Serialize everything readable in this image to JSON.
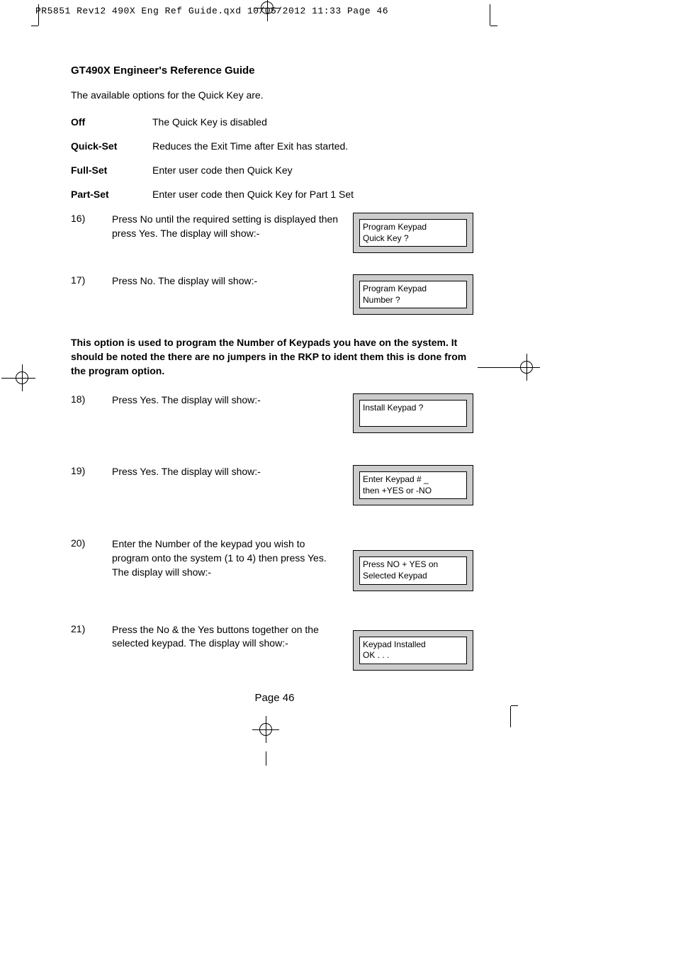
{
  "header": "PR5851 Rev12 490X Eng Ref Guide.qxd  10/05/2012  11:33  Page 46",
  "title": "GT490X Engineer's Reference Guide",
  "intro": "The available options for the Quick Key are.",
  "options": [
    {
      "term": "Off",
      "desc": "The Quick Key is disabled"
    },
    {
      "term": "Quick-Set",
      "desc": "Reduces the Exit Time after Exit has started."
    },
    {
      "term": "Full-Set",
      "desc": "Enter user code then Quick Key"
    },
    {
      "term": "Part-Set",
      "desc": "Enter user code then Quick Key for Part 1 Set"
    }
  ],
  "step16": {
    "num": "16)",
    "text": "Press No until the required setting is displayed then press Yes. The display will show:-",
    "line1": "Program Keypad",
    "line2": "Quick Key ?"
  },
  "step17": {
    "num": "17)",
    "text": "Press No. The display will show:-",
    "line1": "Program Keypad",
    "line2": "Number ?"
  },
  "note": "This option is used to program the Number of Keypads you have on the system. It should be noted the there are no jumpers in the RKP to ident them this is done from the program option.",
  "step18": {
    "num": "18)",
    "text": "Press Yes. The display will show:-",
    "line1": "Install Keypad ?",
    "line2": ""
  },
  "step19": {
    "num": "19)",
    "text": "Press Yes. The display will show:-",
    "line1": "Enter Keypad #   _",
    "line2": "then +YES or -NO"
  },
  "step20": {
    "num": "20)",
    "text": "Enter the Number of the keypad you wish to program onto the system (1 to 4) then press Yes. The display will show:-",
    "line1": "Press NO + YES on",
    "line2": "Selected Keypad"
  },
  "step21": {
    "num": "21)",
    "text": "Press the No & the Yes buttons together on the selected keypad. The display will show:-",
    "line1": "Keypad Installed",
    "line2": "OK . . ."
  },
  "footer": "Page  46"
}
